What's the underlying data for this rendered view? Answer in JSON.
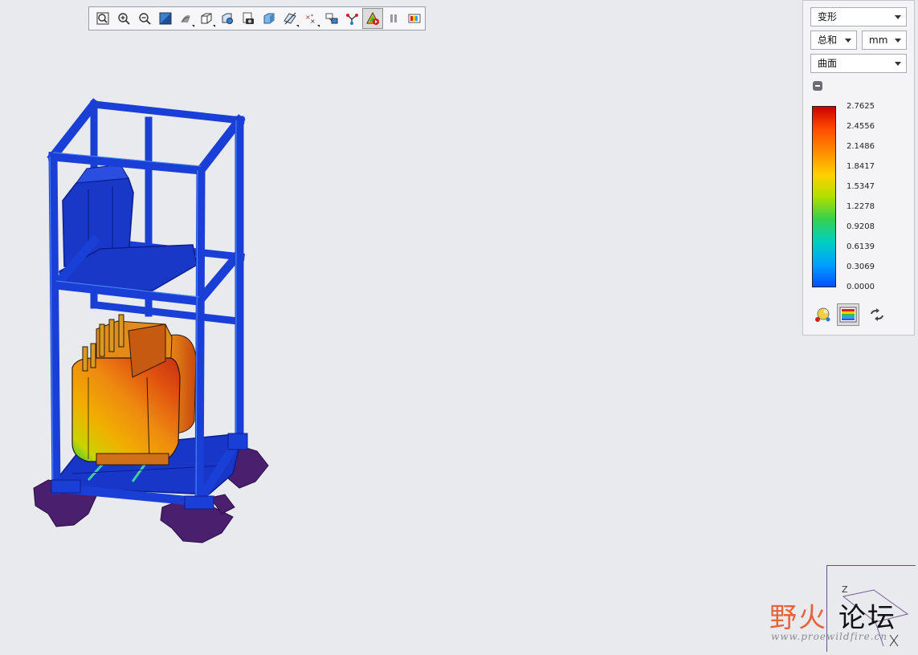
{
  "toolbar": {
    "buttons": [
      {
        "icon": "refit-icon"
      },
      {
        "icon": "zoom-in-icon"
      },
      {
        "icon": "zoom-out-icon"
      },
      {
        "icon": "repaint-icon"
      },
      {
        "icon": "display-style-icon",
        "flyout": true
      },
      {
        "icon": "saved-orientations-icon",
        "flyout": true
      },
      {
        "icon": "view-manager-icon"
      },
      {
        "icon": "snapshot-icon"
      },
      {
        "icon": "shaded-display-icon"
      },
      {
        "icon": "datum-display-icon",
        "flyout": true
      },
      {
        "icon": "annotation-display-icon",
        "flyout": true
      },
      {
        "icon": "spin-center-icon"
      },
      {
        "icon": "spin-center-icon"
      },
      {
        "icon": "connections-icon"
      },
      {
        "icon": "result-animation-icon",
        "active": true
      },
      {
        "icon": "pause-icon"
      },
      {
        "icon": "legend-icon"
      }
    ]
  },
  "panel": {
    "quantity": "变形",
    "component": "总和",
    "units": "mm",
    "display": "曲面",
    "legend": {
      "values": [
        "2.7625",
        "2.4556",
        "2.1486",
        "1.8417",
        "1.5347",
        "1.2278",
        "0.9208",
        "0.6139",
        "0.3069",
        "0.0000"
      ],
      "colors": [
        "#cc0000",
        "#ff4a00",
        "#ff8c00",
        "#ffd000",
        "#b0e000",
        "#39d04a",
        "#00d0c0",
        "#00a0ff",
        "#0050ff"
      ]
    }
  },
  "triad": {
    "axis_label": "Z"
  },
  "watermark": {
    "left": "野火",
    "right": "论坛",
    "url": "www.proewildfire.cn"
  },
  "model": {
    "frame_color": "#1a3fd6",
    "load_color": "#e0701a",
    "support_color": "#4a1f6e"
  }
}
